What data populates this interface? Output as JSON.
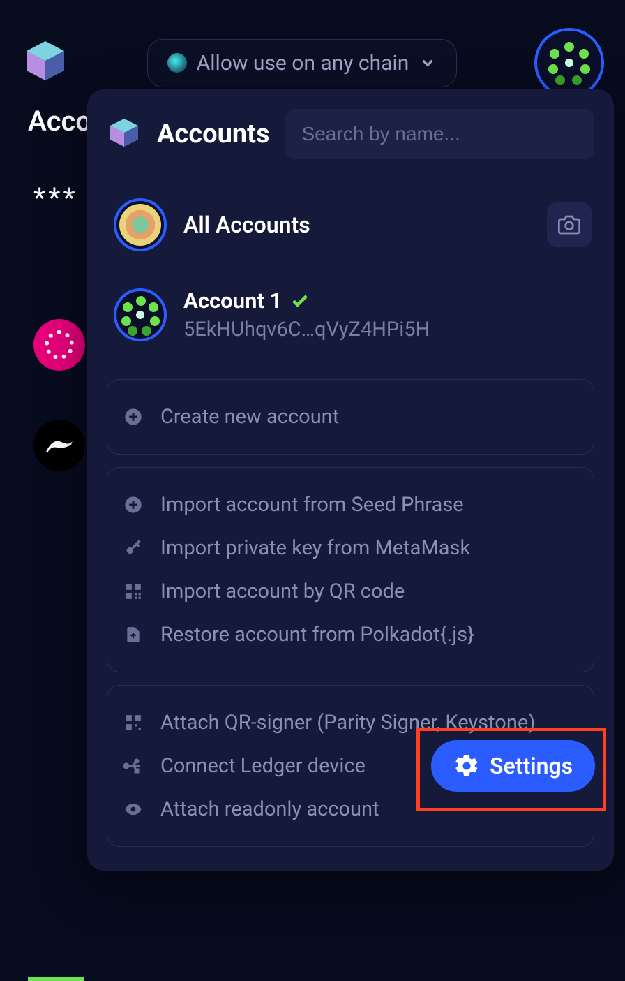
{
  "topbar": {
    "chain_label": "Allow use on any chain"
  },
  "sidebar": {
    "tab_label": "Accounts",
    "stars": "***"
  },
  "panel": {
    "title": "Accounts",
    "search_placeholder": "Search by name...",
    "all_accounts_label": "All Accounts",
    "account": {
      "name": "Account 1",
      "address": "5EkHUhqv6C…qVyZ4HPi5H",
      "verified": true
    },
    "create_label": "Create new account",
    "import_section": [
      "Import account from Seed Phrase",
      "Import private key from MetaMask",
      "Import account by QR code",
      "Restore account from Polkadot{.js}"
    ],
    "attach_section": [
      "Attach QR-signer (Parity Signer, Keystone)",
      "Connect Ledger device",
      "Attach readonly account"
    ]
  },
  "settings_label": "Settings"
}
